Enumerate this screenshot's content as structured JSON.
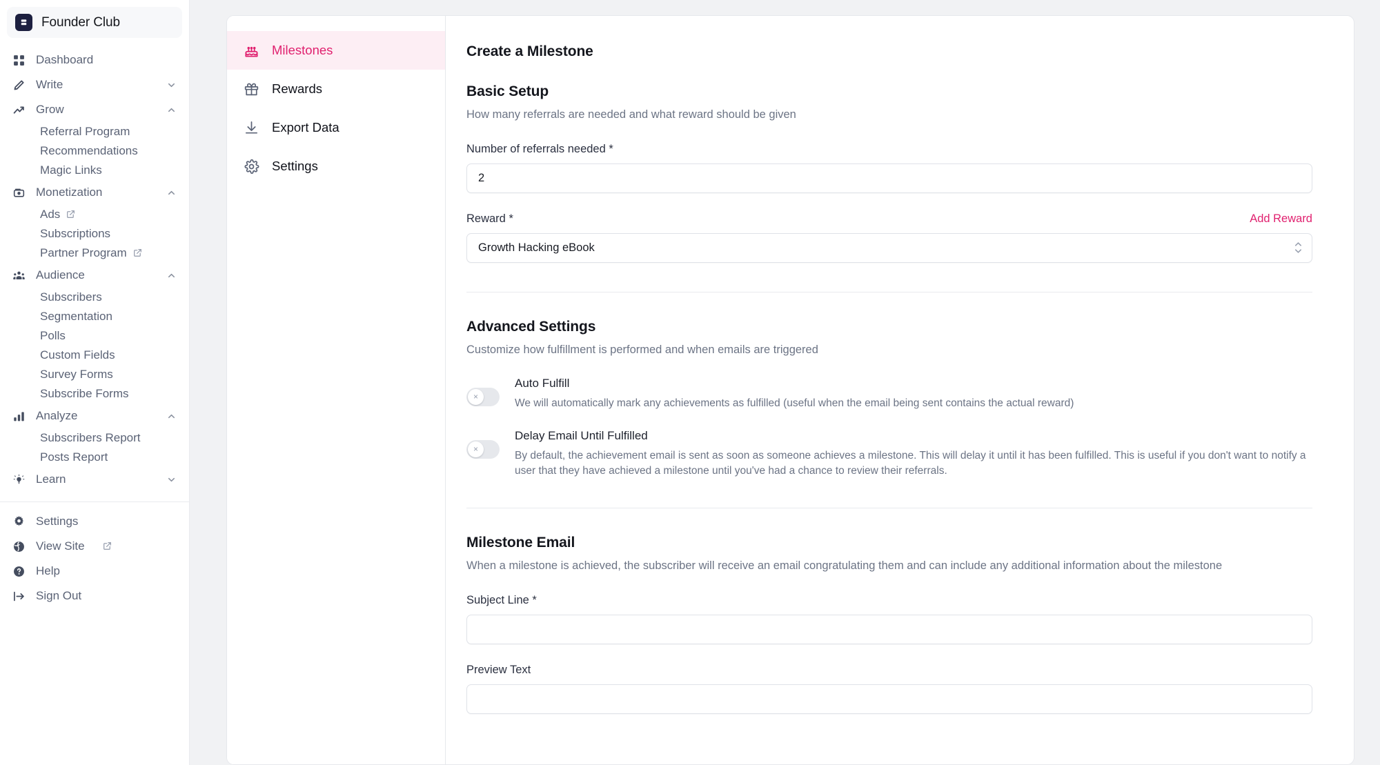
{
  "brand": {
    "name": "Founder Club",
    "logo_icon": "book-logo-icon"
  },
  "sidebar": {
    "items": [
      {
        "label": "Dashboard",
        "icon": "grid-icon",
        "type": "link"
      },
      {
        "label": "Write",
        "icon": "pencil-icon",
        "type": "group",
        "chevron": "down"
      },
      {
        "label": "Grow",
        "icon": "trending-up-icon",
        "type": "group",
        "chevron": "up"
      },
      {
        "label": "Referral Program",
        "type": "sub"
      },
      {
        "label": "Recommendations",
        "type": "sub"
      },
      {
        "label": "Magic Links",
        "type": "sub"
      },
      {
        "label": "Monetization",
        "icon": "money-icon",
        "type": "group",
        "chevron": "up"
      },
      {
        "label": "Ads",
        "type": "sub",
        "external": true
      },
      {
        "label": "Subscriptions",
        "type": "sub"
      },
      {
        "label": "Partner Program",
        "type": "sub",
        "external": true
      },
      {
        "label": "Audience",
        "icon": "users-icon",
        "type": "group",
        "chevron": "up"
      },
      {
        "label": "Subscribers",
        "type": "sub"
      },
      {
        "label": "Segmentation",
        "type": "sub"
      },
      {
        "label": "Polls",
        "type": "sub"
      },
      {
        "label": "Custom Fields",
        "type": "sub"
      },
      {
        "label": "Survey Forms",
        "type": "sub"
      },
      {
        "label": "Subscribe Forms",
        "type": "sub"
      },
      {
        "label": "Analyze",
        "icon": "bar-chart-icon",
        "type": "group",
        "chevron": "up"
      },
      {
        "label": "Subscribers Report",
        "type": "sub"
      },
      {
        "label": "Posts Report",
        "type": "sub"
      },
      {
        "label": "Learn",
        "icon": "lightbulb-icon",
        "type": "group",
        "chevron": "down"
      }
    ],
    "bottom_items": [
      {
        "label": "Settings",
        "icon": "gear-icon"
      },
      {
        "label": "View Site",
        "icon": "globe-icon",
        "external": true
      },
      {
        "label": "Help",
        "icon": "question-circle-icon"
      },
      {
        "label": "Sign Out",
        "icon": "sign-out-icon"
      }
    ]
  },
  "subnav": {
    "items": [
      {
        "label": "Milestones",
        "icon": "cake-icon",
        "active": true
      },
      {
        "label": "Rewards",
        "icon": "gift-icon",
        "active": false
      },
      {
        "label": "Export Data",
        "icon": "download-icon",
        "active": false
      },
      {
        "label": "Settings",
        "icon": "gear-icon",
        "active": false
      }
    ]
  },
  "main": {
    "page_title": "Create a Milestone",
    "basic_setup": {
      "title": "Basic Setup",
      "subtitle": "How many referrals are needed and what reward should be given",
      "referrals_label": "Number of referrals needed *",
      "referrals_value": "2",
      "reward_label": "Reward *",
      "add_reward_label": "Add Reward",
      "reward_value": "Growth Hacking eBook"
    },
    "advanced_settings": {
      "title": "Advanced Settings",
      "subtitle": "Customize how fulfillment is performed and when emails are triggered",
      "toggles": [
        {
          "title": "Auto Fulfill",
          "description": "We will automatically mark any achievements as fulfilled (useful when the email being sent contains the actual reward)",
          "state": "off",
          "knob_glyph": "×"
        },
        {
          "title": "Delay Email Until Fulfilled",
          "description": "By default, the achievement email is sent as soon as someone achieves a milestone. This will delay it until it has been fulfilled. This is useful if you don't want to notify a user that they have achieved a milestone until you've had a chance to review their referrals.",
          "state": "off",
          "knob_glyph": "×"
        }
      ]
    },
    "milestone_email": {
      "title": "Milestone Email",
      "subtitle": "When a milestone is achieved, the subscriber will receive an email congratulating them and can include any additional information about the milestone",
      "subject_label": "Subject Line *",
      "subject_value": "",
      "preview_label": "Preview Text",
      "preview_value": ""
    }
  },
  "colors": {
    "accent": "#e0216f",
    "accent_bg": "#fdeef4",
    "text": "#14161d",
    "muted": "#6c7485",
    "border": "#e6e8ec",
    "page_bg": "#f1f2f4"
  }
}
